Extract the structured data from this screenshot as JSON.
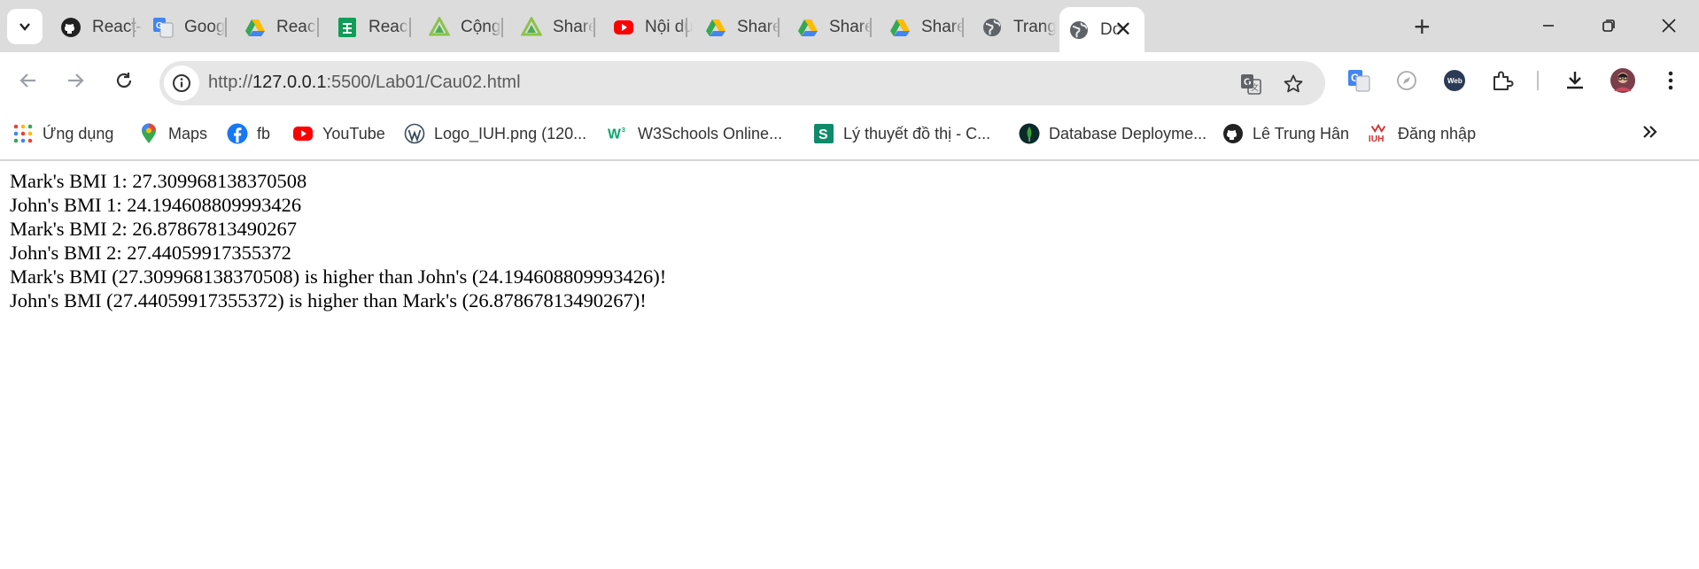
{
  "browser": {
    "tabs": [
      {
        "title": "React-N",
        "icon": "github-icon"
      },
      {
        "title": "Google",
        "icon": "google-translate-icon"
      },
      {
        "title": "ReactN",
        "icon": "google-drive-icon"
      },
      {
        "title": "React_I",
        "icon": "google-sheets-icon"
      },
      {
        "title": "Cộng đ",
        "icon": "sharecode-icon"
      },
      {
        "title": "Sharec",
        "icon": "sharecode-icon"
      },
      {
        "title": "Nội dun",
        "icon": "youtube-icon"
      },
      {
        "title": "Sharec",
        "icon": "google-drive-icon"
      },
      {
        "title": "Sharec",
        "icon": "google-drive-icon"
      },
      {
        "title": "Sharec",
        "icon": "google-drive-icon"
      },
      {
        "title": "Trang c",
        "icon": "globe-icon"
      },
      {
        "title": "Do",
        "icon": "globe-icon",
        "active": true
      }
    ],
    "url_scheme": "http://",
    "url_host": "127.0.0.1",
    "url_path": ":5500/Lab01/Cau02.html",
    "bookmarks": [
      {
        "label": "Ứng dụng",
        "icon": "apps-grid-icon"
      },
      {
        "label": "Maps",
        "icon": "maps-pin-icon"
      },
      {
        "label": "fb",
        "icon": "facebook-icon"
      },
      {
        "label": "YouTube",
        "icon": "youtube-icon"
      },
      {
        "label": "Logo_IUH.png (120...",
        "icon": "wordpress-icon"
      },
      {
        "label": "W3Schools Online...",
        "icon": "w3schools-icon"
      },
      {
        "label": "Lý thuyết đồ thị - C...",
        "icon": "sharecode-s-icon"
      },
      {
        "label": "Database Deployme...",
        "icon": "mongodb-icon"
      },
      {
        "label": "Lê Trung Hân",
        "icon": "github-icon"
      },
      {
        "label": "Đăng nhập",
        "icon": "iuh-icon"
      }
    ]
  },
  "page": {
    "lines": [
      "Mark's BMI 1: 27.309968138370508",
      "John's BMI 1: 24.194608809993426",
      "Mark's BMI 2: 26.87867813490267",
      "John's BMI 2: 27.44059917355372",
      "Mark's BMI (27.309968138370508) is higher than John's (24.194608809993426)!",
      "John's BMI (27.44059917355372) is higher than Mark's (26.87867813490267)!"
    ]
  }
}
